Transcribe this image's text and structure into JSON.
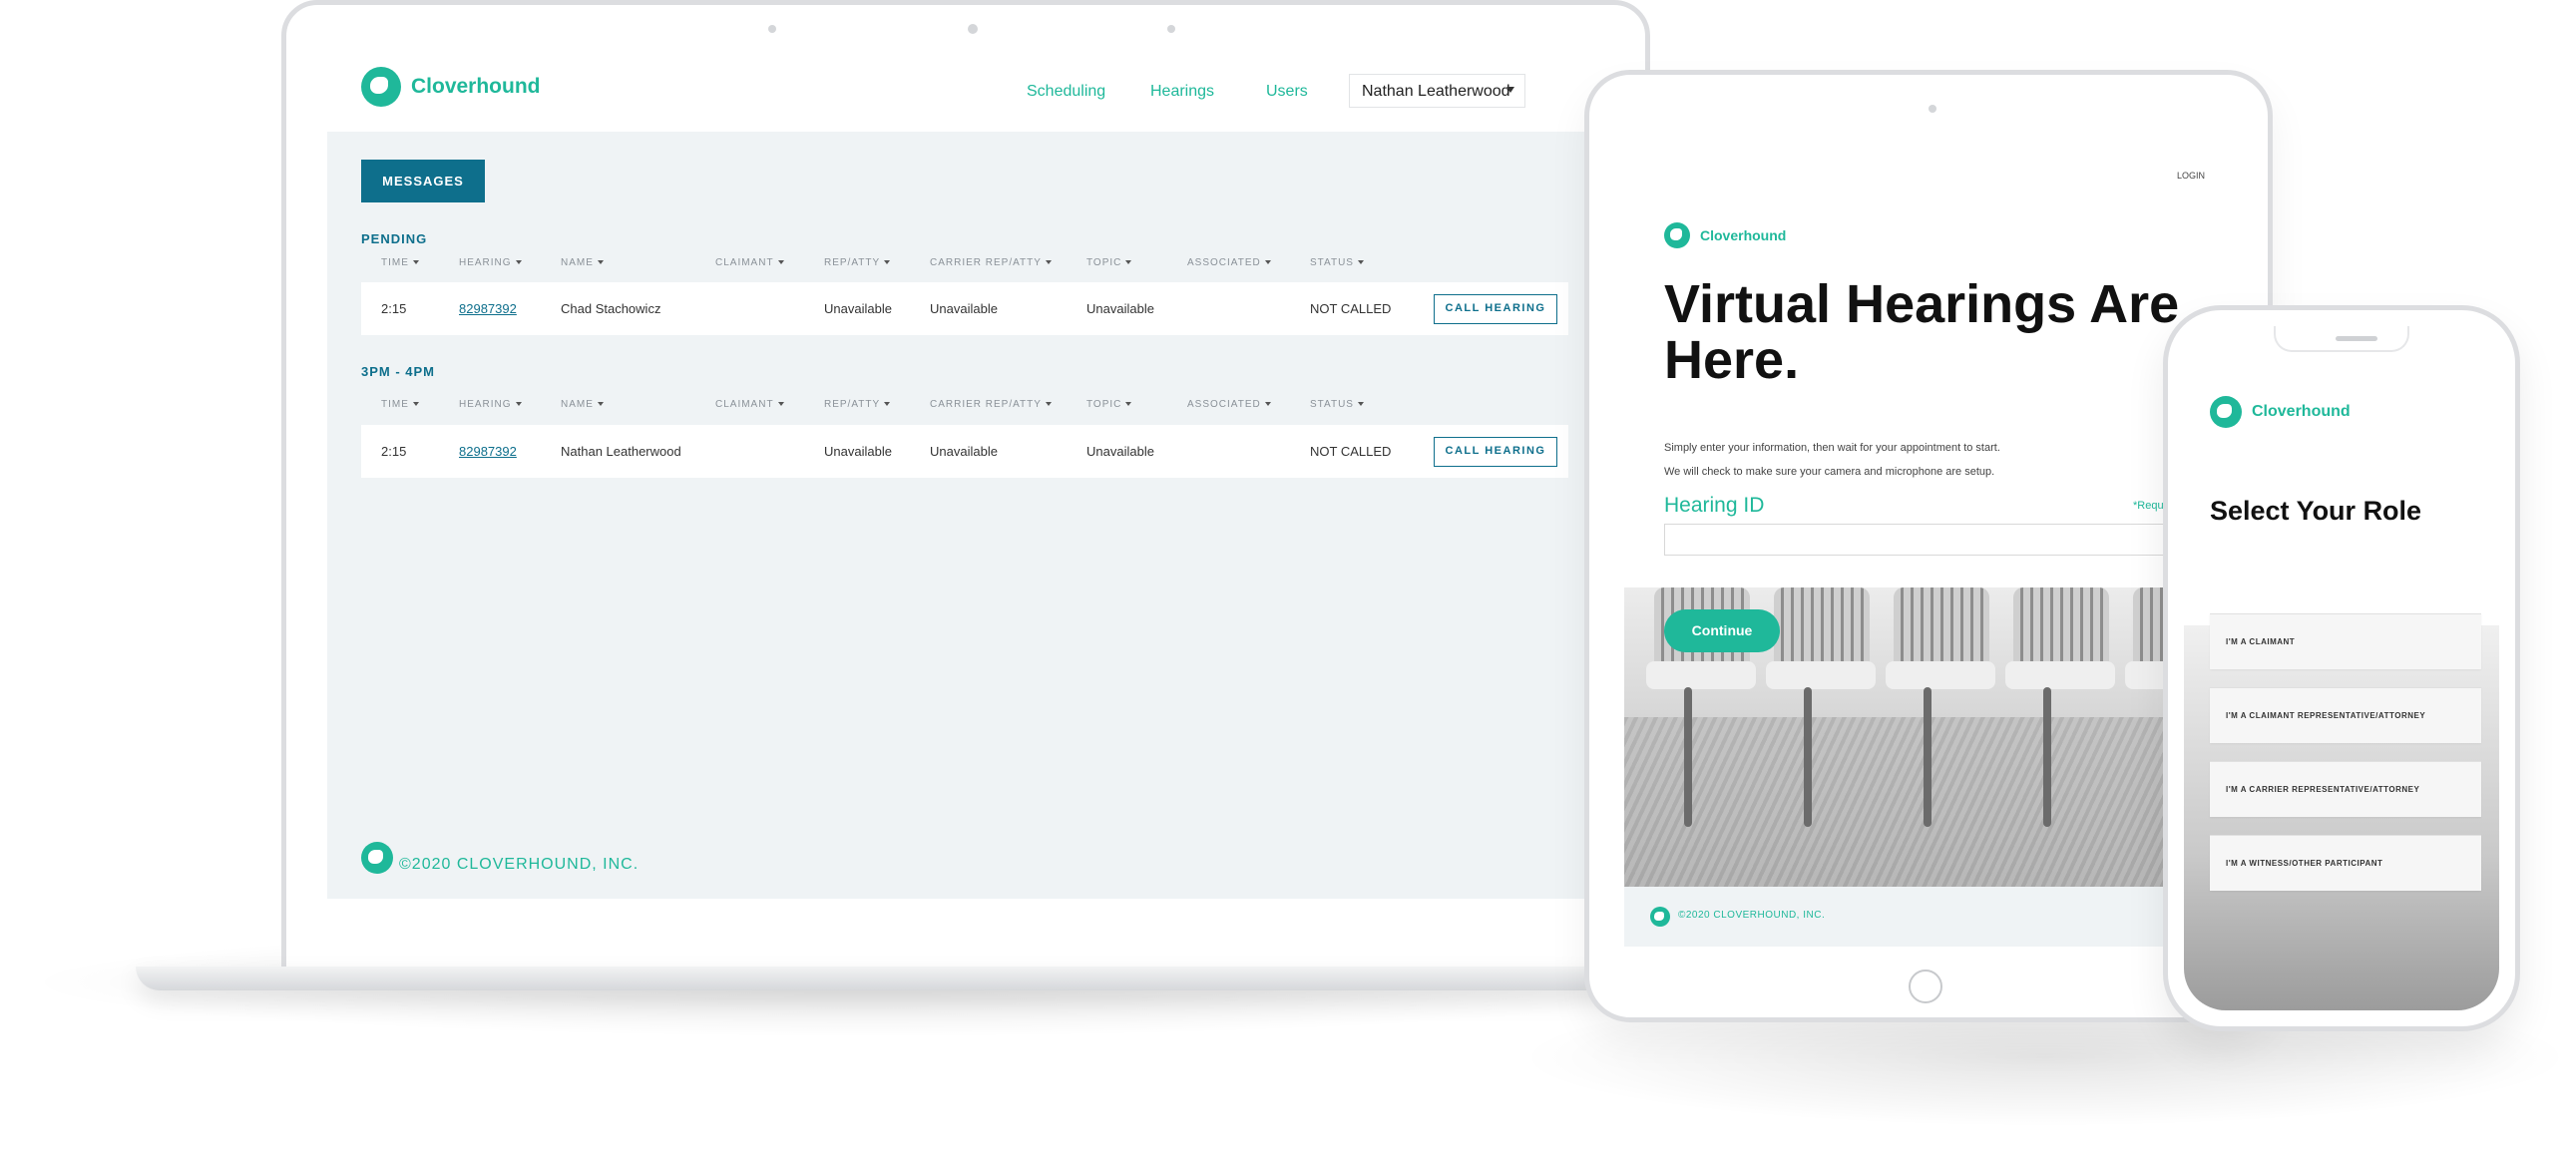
{
  "colors": {
    "brand_green": "#1fb89a",
    "brand_teal": "#0e6f8c",
    "content_bg": "#eff3f5"
  },
  "laptop": {
    "logo_text": "Cloverhound",
    "nav": [
      "Scheduling",
      "Hearings",
      "Users"
    ],
    "user_menu": "Nathan Leatherwood",
    "messages_button": "MESSAGES",
    "columns": [
      "TIME",
      "HEARING",
      "NAME",
      "CLAIMANT",
      "REP/ATTY",
      "CARRIER REP/ATTY",
      "TOPIC",
      "ASSOCIATED",
      "STATUS"
    ],
    "groups": [
      {
        "label": "PENDING",
        "rows": [
          {
            "time": "2:15",
            "hearing": "82987392",
            "name": "Chad Stachowicz",
            "claimant": "",
            "rep": "Unavailable",
            "carrier": "Unavailable",
            "topic": "Unavailable",
            "associated": "",
            "status": "NOT CALLED",
            "action": "CALL HEARING"
          }
        ]
      },
      {
        "label": "3PM - 4PM",
        "rows": [
          {
            "time": "2:15",
            "hearing": "82987392",
            "name": "Nathan Leatherwood",
            "claimant": "",
            "rep": "Unavailable",
            "carrier": "Unavailable",
            "topic": "Unavailable",
            "associated": "",
            "status": "NOT CALLED",
            "action": "CALL HEARING"
          }
        ]
      }
    ],
    "footer": "©2020 CLOVERHOUND, INC."
  },
  "tablet": {
    "login": "LOGIN",
    "logo_text": "Cloverhound",
    "title_line1": "Virtual Hearings Are",
    "title_line2": "Here.",
    "text1": "Simply enter your information, then wait for your appointment to start.",
    "text2": "We will check to make sure your camera and microphone are setup.",
    "field_label": "Hearing ID",
    "required": "*Requi",
    "continue": "Continue",
    "footer": "©2020 CLOVERHOUND, INC."
  },
  "phone": {
    "logo_text": "Cloverhound",
    "title": "Select Your Role",
    "roles": [
      "I'M A CLAIMANT",
      "I'M A CLAIMANT REPRESENTATIVE/ATTORNEY",
      "I'M A CARRIER REPRESENTATIVE/ATTORNEY",
      "I'M A WITNESS/OTHER PARTICIPANT"
    ]
  }
}
